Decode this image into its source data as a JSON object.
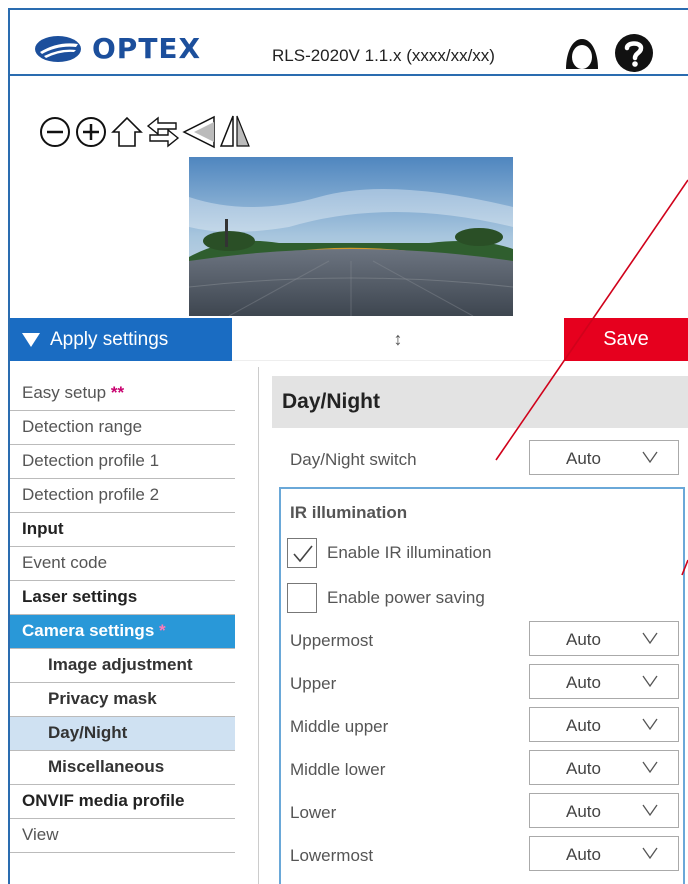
{
  "header": {
    "brand": "OPTEX",
    "model": "RLS-2020V 1.1.x (xxxx/xx/xx)",
    "icons": [
      "login-icon",
      "help-icon"
    ]
  },
  "toolbar": {
    "icons": [
      "zoom-out-icon",
      "zoom-in-icon",
      "home-icon",
      "swap-arrows-icon",
      "triangle-left-icon",
      "flip-horizontal-icon"
    ]
  },
  "actions": {
    "apply_label": "Apply settings",
    "resize_glyph": "↕",
    "save_label": "Save"
  },
  "sidebar": {
    "items": [
      {
        "label": "Easy setup",
        "mark": "**"
      },
      {
        "label": "Detection range",
        "mark": ""
      },
      {
        "label": "Detection profile 1",
        "mark": ""
      },
      {
        "label": "Detection profile 2",
        "mark": ""
      },
      {
        "label": "Input",
        "mark": ""
      },
      {
        "label": "Event code",
        "mark": ""
      },
      {
        "label": "Laser settings",
        "mark": ""
      },
      {
        "label": "Camera settings",
        "mark": "*"
      },
      {
        "label": "Image adjustment",
        "mark": ""
      },
      {
        "label": "Privacy mask",
        "mark": ""
      },
      {
        "label": "Day/Night",
        "mark": ""
      },
      {
        "label": "Miscellaneous",
        "mark": ""
      },
      {
        "label": "ONVIF media profile",
        "mark": ""
      },
      {
        "label": "View",
        "mark": ""
      }
    ]
  },
  "main": {
    "section_title": "Day/Night",
    "day_night_switch": {
      "label": "Day/Night switch",
      "value": "Auto"
    },
    "ir": {
      "title": "IR illumination",
      "enable_ir": {
        "label": "Enable IR illumination",
        "checked": true
      },
      "power_saving": {
        "label": "Enable power saving",
        "checked": false
      },
      "levels": [
        {
          "label": "Uppermost",
          "value": "Auto"
        },
        {
          "label": "Upper",
          "value": "Auto"
        },
        {
          "label": "Middle upper",
          "value": "Auto"
        },
        {
          "label": "Middle lower",
          "value": "Auto"
        },
        {
          "label": "Lower",
          "value": "Auto"
        },
        {
          "label": "Lowermost",
          "value": "Auto"
        }
      ]
    }
  },
  "colors": {
    "accent": "#1a6cc2",
    "active": "#2998d8",
    "save": "#e6001e",
    "brand": "#1c4f9c"
  }
}
